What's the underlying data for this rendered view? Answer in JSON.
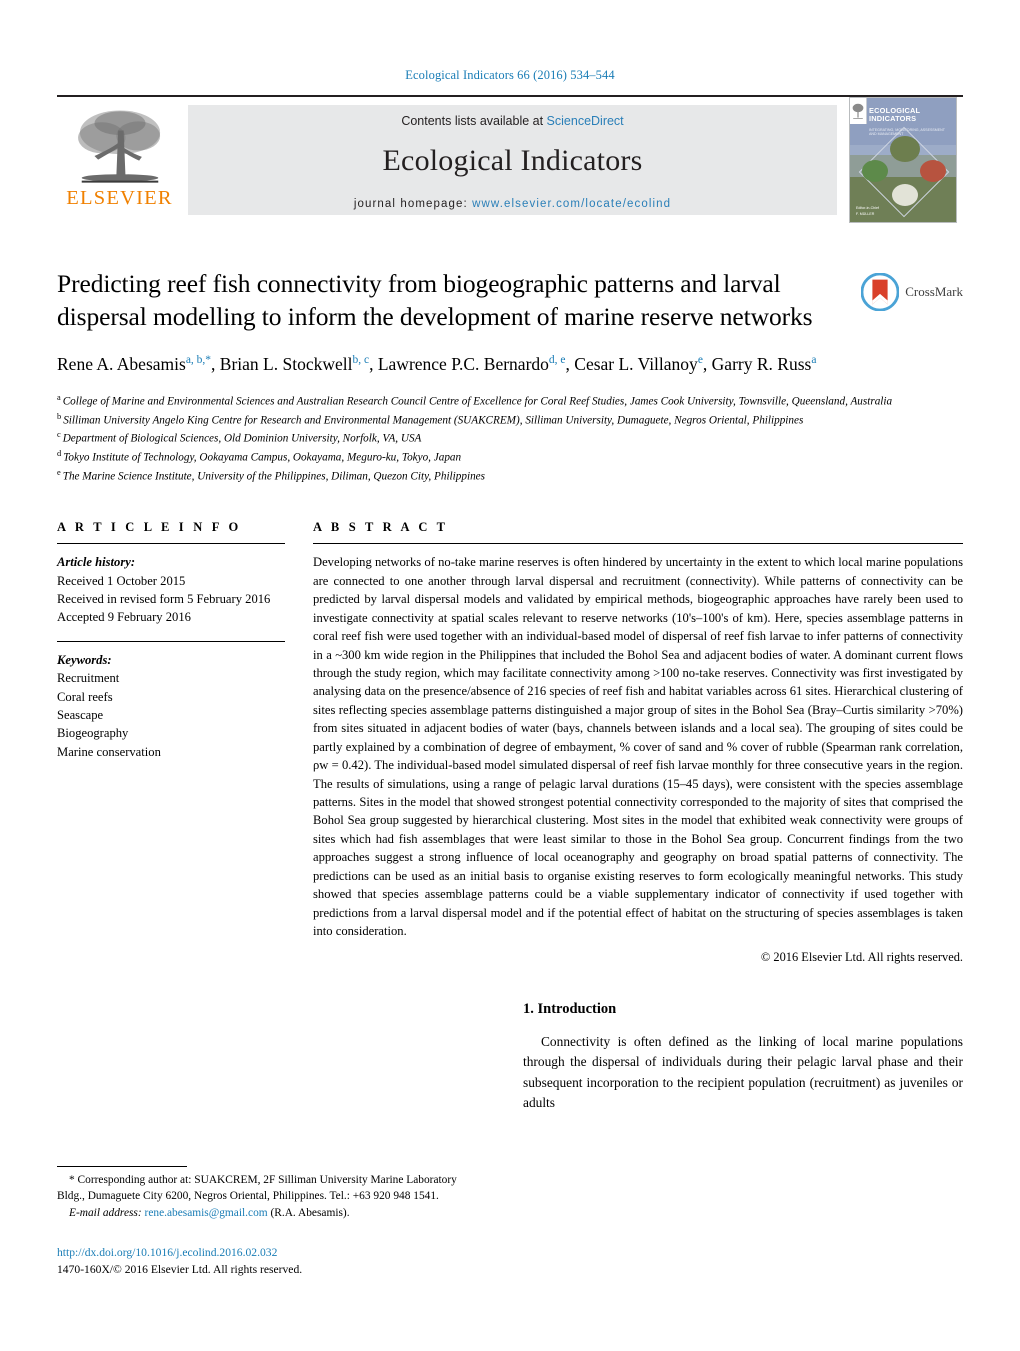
{
  "running_head": "Ecological Indicators 66 (2016) 534–544",
  "masthead": {
    "publisher_name": "ELSEVIER",
    "contents_prefix": "Contents lists available at ",
    "contents_link": "ScienceDirect",
    "journal_name": "Ecological Indicators",
    "homepage_prefix": "journal homepage: ",
    "homepage_url": "www.elsevier.com/locate/ecolind",
    "cover": {
      "title_line1": "ECOLOGICAL",
      "title_line2": "INDICATORS",
      "subtitle": "INTEGRATING, MONITORING, ASSESSMENT AND MANAGEMENT",
      "footer_line1": "Editor-in-Chief",
      "footer_line2": "F. MÜLLER"
    }
  },
  "article": {
    "title": "Predicting reef fish connectivity from biogeographic patterns and larval dispersal modelling to inform the development of marine reserve networks",
    "crossmark_label": "CrossMark",
    "authors": [
      {
        "name": "Rene A. Abesamis",
        "marks": "a, b,",
        "star": "*",
        "sep": ", "
      },
      {
        "name": "Brian L. Stockwell",
        "marks": "b, c",
        "star": "",
        "sep": ", "
      },
      {
        "name": "Lawrence P.C. Bernardo",
        "marks": "d, e",
        "star": "",
        "sep": ", "
      },
      {
        "name": "Cesar L. Villanoy",
        "marks": "e",
        "star": "",
        "sep": ", "
      },
      {
        "name": "Garry R. Russ",
        "marks": "a",
        "star": "",
        "sep": ""
      }
    ],
    "affiliations": [
      {
        "mark": "a",
        "text": "College of Marine and Environmental Sciences and Australian Research Council Centre of Excellence for Coral Reef Studies, James Cook University, Townsville, Queensland, Australia"
      },
      {
        "mark": "b",
        "text": "Silliman University Angelo King Centre for Research and Environmental Management (SUAKCREM), Silliman University, Dumaguete, Negros Oriental, Philippines"
      },
      {
        "mark": "c",
        "text": "Department of Biological Sciences, Old Dominion University, Norfolk, VA, USA"
      },
      {
        "mark": "d",
        "text": "Tokyo Institute of Technology, Ookayama Campus, Ookayama, Meguro-ku, Tokyo, Japan"
      },
      {
        "mark": "e",
        "text": "The Marine Science Institute, University of the Philippines, Diliman, Quezon City, Philippines"
      }
    ]
  },
  "article_info": {
    "heading": "A R T I C L E    I N F O",
    "history_label": "Article history:",
    "history": [
      "Received 1 October 2015",
      "Received in revised form 5 February 2016",
      "Accepted 9 February 2016"
    ],
    "keywords_label": "Keywords:",
    "keywords": [
      "Recruitment",
      "Coral reefs",
      "Seascape",
      "Biogeography",
      "Marine conservation"
    ]
  },
  "abstract": {
    "heading": "A B S T R A C T",
    "body": "Developing networks of no-take marine reserves is often hindered by uncertainty in the extent to which local marine populations are connected to one another through larval dispersal and recruitment (connectivity). While patterns of connectivity can be predicted by larval dispersal models and validated by empirical methods, biogeographic approaches have rarely been used to investigate connectivity at spatial scales relevant to reserve networks (10's–100's of km). Here, species assemblage patterns in coral reef fish were used together with an individual-based model of dispersal of reef fish larvae to infer patterns of connectivity in a ~300 km wide region in the Philippines that included the Bohol Sea and adjacent bodies of water. A dominant current flows through the study region, which may facilitate connectivity among >100 no-take reserves. Connectivity was first investigated by analysing data on the presence/absence of 216 species of reef fish and habitat variables across 61 sites. Hierarchical clustering of sites reflecting species assemblage patterns distinguished a major group of sites in the Bohol Sea (Bray–Curtis similarity >70%) from sites situated in adjacent bodies of water (bays, channels between islands and a local sea). The grouping of sites could be partly explained by a combination of degree of embayment, % cover of sand and % cover of rubble (Spearman rank correlation, ρw = 0.42). The individual-based model simulated dispersal of reef fish larvae monthly for three consecutive years in the region. The results of simulations, using a range of pelagic larval durations (15–45 days), were consistent with the species assemblage patterns. Sites in the model that showed strongest potential connectivity corresponded to the majority of sites that comprised the Bohol Sea group suggested by hierarchical clustering. Most sites in the model that exhibited weak connectivity were groups of sites which had fish assemblages that were least similar to those in the Bohol Sea group. Concurrent findings from the two approaches suggest a strong influence of local oceanography and geography on broad spatial patterns of connectivity. The predictions can be used as an initial basis to organise existing reserves to form ecologically meaningful networks. This study showed that species assemblage patterns could be a viable supplementary indicator of connectivity if used together with predictions from a larval dispersal model and if the potential effect of habitat on the structuring of species assemblages is taken into consideration.",
    "copyright": "© 2016 Elsevier Ltd. All rights reserved."
  },
  "introduction": {
    "heading": "1. Introduction",
    "paragraph": "Connectivity is often defined as the linking of local marine populations through the dispersal of individuals during their pelagic larval phase and their subsequent incorporation to the recipient population (recruitment) as juveniles or adults"
  },
  "footnote": {
    "line1": "* Corresponding author at: SUAKCREM, 2F Silliman University Marine Laboratory",
    "line2": "Bldg., Dumaguete City 6200, Negros Oriental, Philippines. Tel.: +63 920 948 1541.",
    "email_label": "E-mail address:",
    "email": "rene.abesamis@gmail.com",
    "email_suffix": " (R.A. Abesamis)."
  },
  "footer": {
    "doi": "http://dx.doi.org/10.1016/j.ecolind.2016.02.032",
    "issn": "1470-160X/© 2016 Elsevier Ltd. All rights reserved."
  },
  "colors": {
    "link_blue": "#1a7db6",
    "elsevier_orange": "#f08000",
    "masthead_grey": "#e7e8e9"
  }
}
